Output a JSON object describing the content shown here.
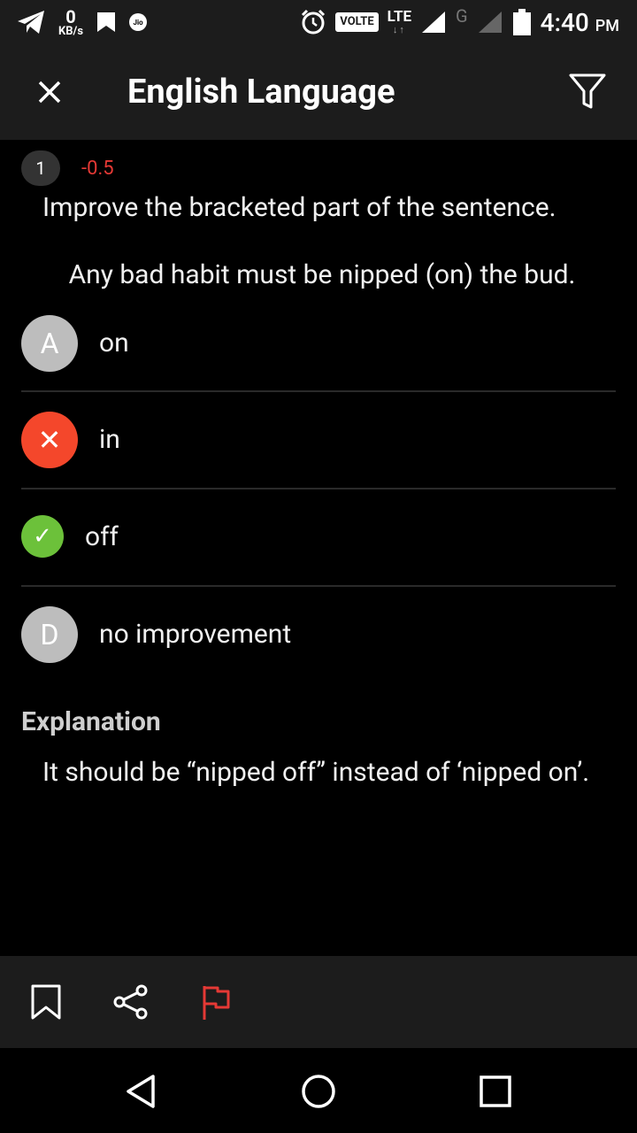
{
  "status_bar": {
    "speed_value": "0",
    "speed_unit": "KB/s",
    "carrier_badge": "Jio",
    "volte_label": "VOLTE",
    "network_label": "LTE",
    "secondary_network": "G",
    "time": "4:40",
    "time_suffix": "PM"
  },
  "app_bar": {
    "title": "English Language"
  },
  "question": {
    "number": "1",
    "marks": "-0.5",
    "instruction": "Improve the bracketed part of the sentence.",
    "sentence": "Any bad habit must be nipped (on) the bud."
  },
  "options": [
    {
      "badge": "A",
      "text": "on",
      "state": "neutral"
    },
    {
      "badge": "✕",
      "text": "in",
      "state": "wrong"
    },
    {
      "badge": "✓",
      "text": "off",
      "state": "correct"
    },
    {
      "badge": "D",
      "text": "no improvement",
      "state": "neutral"
    }
  ],
  "explanation": {
    "title": "Explanation",
    "text": "It should be “nipped off” instead of ‘nipped on’."
  },
  "colors": {
    "wrong": "#f4472b",
    "correct": "#6cc13a",
    "marks": "#e53935",
    "report_flag": "#e53935"
  },
  "icons": [
    "telegram-icon",
    "bookmark-notification-icon",
    "alarm-icon",
    "signal-icon",
    "battery-icon",
    "close-icon",
    "filter-icon",
    "bookmark-icon",
    "share-icon",
    "flag-icon",
    "nav-back-icon",
    "nav-home-icon",
    "nav-recents-icon"
  ]
}
